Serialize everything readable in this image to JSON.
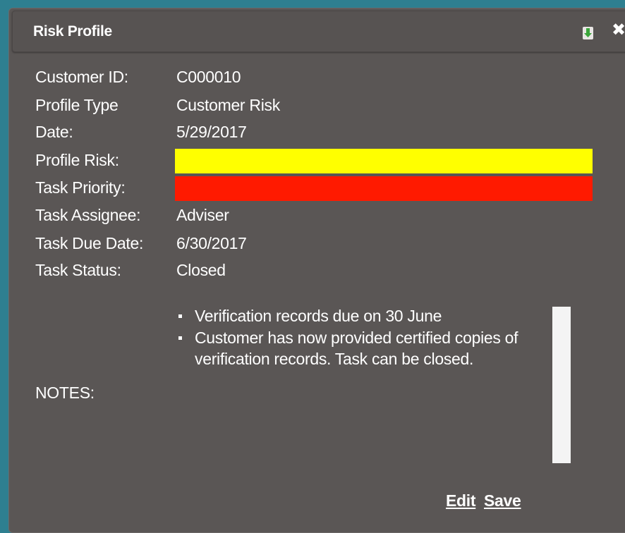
{
  "panel": {
    "title": "Risk Profile"
  },
  "fields": {
    "customer_id": {
      "label": "Customer ID:",
      "value": "C000010"
    },
    "profile_type": {
      "label": "Profile Type",
      "value": "Customer Risk"
    },
    "date": {
      "label": "Date:",
      "value": "5/29/2017"
    },
    "profile_risk": {
      "label": "Profile Risk:",
      "color": "#ffff00"
    },
    "task_priority": {
      "label": "Task Priority:",
      "color": "#ff1a00"
    },
    "task_assignee": {
      "label": "Task Assignee:",
      "value": "Adviser"
    },
    "task_due_date": {
      "label": "Task Due Date:",
      "value": "6/30/2017"
    },
    "task_status": {
      "label": "Task Status:",
      "value": "Closed"
    }
  },
  "notes": {
    "label": "NOTES:",
    "items": [
      "Verification records due on 30 June",
      "Customer has now provided certified copies of verification records. Task can be closed."
    ]
  },
  "actions": {
    "edit_label": "Edit",
    "save_label": "Save"
  },
  "icons": {
    "download": "download-arrow-icon",
    "close": "close-icon"
  },
  "colors": {
    "background": "#2e7f90",
    "panel": "#5a5655",
    "download_arrow": "#3aa53a"
  }
}
